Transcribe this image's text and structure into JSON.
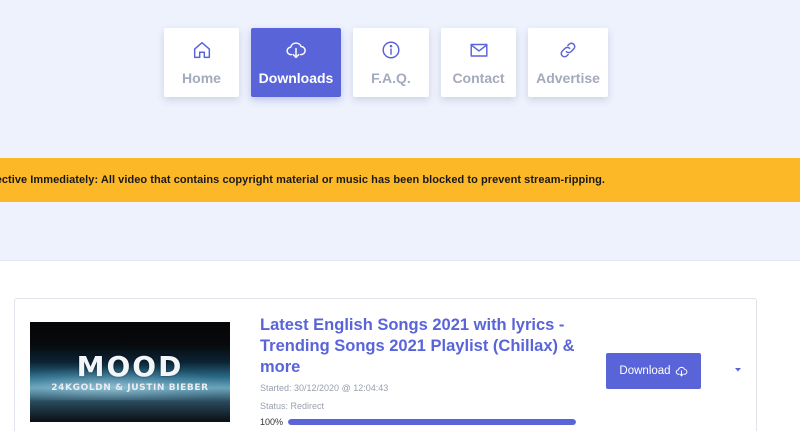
{
  "nav": {
    "items": [
      {
        "label": "Home",
        "icon": "home-icon"
      },
      {
        "label": "Downloads",
        "icon": "cloud-download-icon",
        "active": true
      },
      {
        "label": "F.A.Q.",
        "icon": "info-icon"
      },
      {
        "label": "Contact",
        "icon": "mail-icon"
      },
      {
        "label": "Advertise",
        "icon": "link-icon"
      }
    ]
  },
  "notice": {
    "text": "fective Immediately: All video that contains copyright material or music has been blocked to prevent stream-ripping."
  },
  "download_item": {
    "thumbnail_title": "MOOD",
    "thumbnail_artist": "24KGOLDN & JUSTIN BIEBER",
    "title": "Latest English Songs 2021 with lyrics - Trending Songs 2021 Playlist (Chillax) & more",
    "started": "Started: 30/12/2020 @ 12:04:43",
    "status": "Status: Redirect",
    "progress_label": "100%",
    "progress": 1.0,
    "download_label": "Download",
    "download_icon": "cloud-download-icon",
    "menu_icon": "caret-down-icon"
  },
  "colors": {
    "accent": "#5a64d9",
    "banner": "#fdb827",
    "background": "#eef2fd",
    "muted_text": "#a3aabb"
  }
}
